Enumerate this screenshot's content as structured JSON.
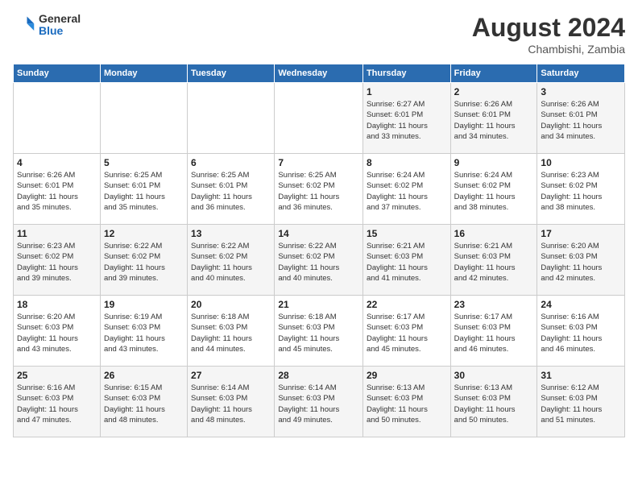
{
  "header": {
    "logo_general": "General",
    "logo_blue": "Blue",
    "month_year": "August 2024",
    "location": "Chambishi, Zambia"
  },
  "days_of_week": [
    "Sunday",
    "Monday",
    "Tuesday",
    "Wednesday",
    "Thursday",
    "Friday",
    "Saturday"
  ],
  "weeks": [
    [
      {
        "day": "",
        "info": ""
      },
      {
        "day": "",
        "info": ""
      },
      {
        "day": "",
        "info": ""
      },
      {
        "day": "",
        "info": ""
      },
      {
        "day": "1",
        "info": "Sunrise: 6:27 AM\nSunset: 6:01 PM\nDaylight: 11 hours\nand 33 minutes."
      },
      {
        "day": "2",
        "info": "Sunrise: 6:26 AM\nSunset: 6:01 PM\nDaylight: 11 hours\nand 34 minutes."
      },
      {
        "day": "3",
        "info": "Sunrise: 6:26 AM\nSunset: 6:01 PM\nDaylight: 11 hours\nand 34 minutes."
      }
    ],
    [
      {
        "day": "4",
        "info": "Sunrise: 6:26 AM\nSunset: 6:01 PM\nDaylight: 11 hours\nand 35 minutes."
      },
      {
        "day": "5",
        "info": "Sunrise: 6:25 AM\nSunset: 6:01 PM\nDaylight: 11 hours\nand 35 minutes."
      },
      {
        "day": "6",
        "info": "Sunrise: 6:25 AM\nSunset: 6:01 PM\nDaylight: 11 hours\nand 36 minutes."
      },
      {
        "day": "7",
        "info": "Sunrise: 6:25 AM\nSunset: 6:02 PM\nDaylight: 11 hours\nand 36 minutes."
      },
      {
        "day": "8",
        "info": "Sunrise: 6:24 AM\nSunset: 6:02 PM\nDaylight: 11 hours\nand 37 minutes."
      },
      {
        "day": "9",
        "info": "Sunrise: 6:24 AM\nSunset: 6:02 PM\nDaylight: 11 hours\nand 38 minutes."
      },
      {
        "day": "10",
        "info": "Sunrise: 6:23 AM\nSunset: 6:02 PM\nDaylight: 11 hours\nand 38 minutes."
      }
    ],
    [
      {
        "day": "11",
        "info": "Sunrise: 6:23 AM\nSunset: 6:02 PM\nDaylight: 11 hours\nand 39 minutes."
      },
      {
        "day": "12",
        "info": "Sunrise: 6:22 AM\nSunset: 6:02 PM\nDaylight: 11 hours\nand 39 minutes."
      },
      {
        "day": "13",
        "info": "Sunrise: 6:22 AM\nSunset: 6:02 PM\nDaylight: 11 hours\nand 40 minutes."
      },
      {
        "day": "14",
        "info": "Sunrise: 6:22 AM\nSunset: 6:02 PM\nDaylight: 11 hours\nand 40 minutes."
      },
      {
        "day": "15",
        "info": "Sunrise: 6:21 AM\nSunset: 6:03 PM\nDaylight: 11 hours\nand 41 minutes."
      },
      {
        "day": "16",
        "info": "Sunrise: 6:21 AM\nSunset: 6:03 PM\nDaylight: 11 hours\nand 42 minutes."
      },
      {
        "day": "17",
        "info": "Sunrise: 6:20 AM\nSunset: 6:03 PM\nDaylight: 11 hours\nand 42 minutes."
      }
    ],
    [
      {
        "day": "18",
        "info": "Sunrise: 6:20 AM\nSunset: 6:03 PM\nDaylight: 11 hours\nand 43 minutes."
      },
      {
        "day": "19",
        "info": "Sunrise: 6:19 AM\nSunset: 6:03 PM\nDaylight: 11 hours\nand 43 minutes."
      },
      {
        "day": "20",
        "info": "Sunrise: 6:18 AM\nSunset: 6:03 PM\nDaylight: 11 hours\nand 44 minutes."
      },
      {
        "day": "21",
        "info": "Sunrise: 6:18 AM\nSunset: 6:03 PM\nDaylight: 11 hours\nand 45 minutes."
      },
      {
        "day": "22",
        "info": "Sunrise: 6:17 AM\nSunset: 6:03 PM\nDaylight: 11 hours\nand 45 minutes."
      },
      {
        "day": "23",
        "info": "Sunrise: 6:17 AM\nSunset: 6:03 PM\nDaylight: 11 hours\nand 46 minutes."
      },
      {
        "day": "24",
        "info": "Sunrise: 6:16 AM\nSunset: 6:03 PM\nDaylight: 11 hours\nand 46 minutes."
      }
    ],
    [
      {
        "day": "25",
        "info": "Sunrise: 6:16 AM\nSunset: 6:03 PM\nDaylight: 11 hours\nand 47 minutes."
      },
      {
        "day": "26",
        "info": "Sunrise: 6:15 AM\nSunset: 6:03 PM\nDaylight: 11 hours\nand 48 minutes."
      },
      {
        "day": "27",
        "info": "Sunrise: 6:14 AM\nSunset: 6:03 PM\nDaylight: 11 hours\nand 48 minutes."
      },
      {
        "day": "28",
        "info": "Sunrise: 6:14 AM\nSunset: 6:03 PM\nDaylight: 11 hours\nand 49 minutes."
      },
      {
        "day": "29",
        "info": "Sunrise: 6:13 AM\nSunset: 6:03 PM\nDaylight: 11 hours\nand 50 minutes."
      },
      {
        "day": "30",
        "info": "Sunrise: 6:13 AM\nSunset: 6:03 PM\nDaylight: 11 hours\nand 50 minutes."
      },
      {
        "day": "31",
        "info": "Sunrise: 6:12 AM\nSunset: 6:03 PM\nDaylight: 11 hours\nand 51 minutes."
      }
    ]
  ]
}
